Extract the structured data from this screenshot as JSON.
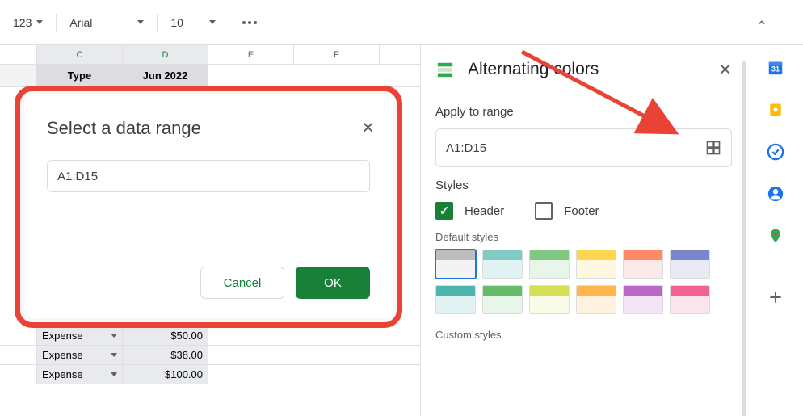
{
  "toolbar": {
    "format": "123",
    "font": "Arial",
    "fontsize": "10"
  },
  "columns": [
    "C",
    "D",
    "E",
    "F"
  ],
  "headers": {
    "type": "Type",
    "month": "Jun 2022"
  },
  "rows": [
    {
      "type": "Expense",
      "amount": "$50.00"
    },
    {
      "type": "Expense",
      "amount": "$38.00"
    },
    {
      "type": "Expense",
      "amount": "$100.00"
    }
  ],
  "dialog": {
    "title": "Select a data range",
    "value": "A1:D15",
    "cancel": "Cancel",
    "ok": "OK"
  },
  "panel": {
    "title": "Alternating colors",
    "applyLabel": "Apply to range",
    "range": "A1:D15",
    "stylesLabel": "Styles",
    "headerLabel": "Header",
    "footerLabel": "Footer",
    "defaultLabel": "Default styles",
    "customLabel": "Custom styles",
    "swatches": [
      {
        "h": "#bdbdbd",
        "b": "#f3f3f3"
      },
      {
        "h": "#80cbc4",
        "b": "#e0f2f1"
      },
      {
        "h": "#81c784",
        "b": "#e8f5e9"
      },
      {
        "h": "#ffd54f",
        "b": "#fff8e1"
      },
      {
        "h": "#ff8a65",
        "b": "#fbe9e7"
      },
      {
        "h": "#7986cb",
        "b": "#e8eaf6"
      },
      {
        "h": "#4db6ac",
        "b": "#e0f2f1"
      },
      {
        "h": "#66bb6a",
        "b": "#e8f5e9"
      },
      {
        "h": "#d4e157",
        "b": "#f9fbe7"
      },
      {
        "h": "#ffb74d",
        "b": "#fff3e0"
      },
      {
        "h": "#ba68c8",
        "b": "#f3e5f5"
      },
      {
        "h": "#f06292",
        "b": "#fce4ec"
      }
    ]
  }
}
